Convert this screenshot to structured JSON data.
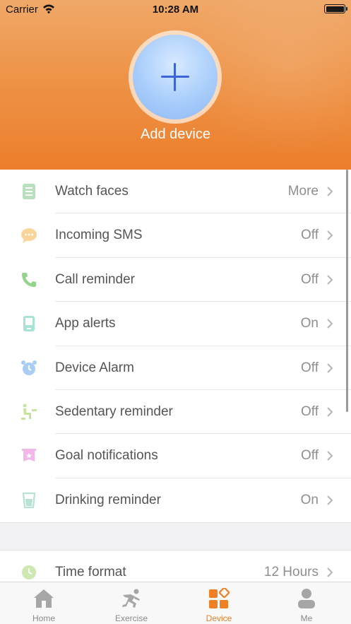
{
  "status_bar": {
    "carrier": "Carrier",
    "time": "10:28 AM"
  },
  "header": {
    "add_device_label": "Add device"
  },
  "settings": [
    {
      "label": "Watch faces",
      "value": "More",
      "icon": "watch-face-icon",
      "color": "#b9dfbd"
    },
    {
      "label": "Incoming SMS",
      "value": "Off",
      "icon": "chat-bubble-icon",
      "color": "#f9d59a"
    },
    {
      "label": "Call reminder",
      "value": "Off",
      "icon": "phone-icon",
      "color": "#93d38b"
    },
    {
      "label": "App alerts",
      "value": "On",
      "icon": "phone-alert-icon",
      "color": "#a9e3d6"
    },
    {
      "label": "Device Alarm",
      "value": "Off",
      "icon": "alarm-clock-icon",
      "color": "#a9cdf3"
    },
    {
      "label": "Sedentary reminder",
      "value": "Off",
      "icon": "sitting-person-icon",
      "color": "#c6e59b"
    },
    {
      "label": "Goal notifications",
      "value": "Off",
      "icon": "goal-flag-icon",
      "color": "#f3b6e8"
    },
    {
      "label": "Drinking reminder",
      "value": "On",
      "icon": "water-glass-icon",
      "color": "#b8e2d3"
    }
  ],
  "time_format": {
    "label": "Time format",
    "value": "12 Hours",
    "icon": "clock-icon",
    "color": "#cde8b0"
  },
  "tabs": [
    {
      "label": "Home",
      "icon": "home-icon",
      "active": false
    },
    {
      "label": "Exercise",
      "icon": "running-icon",
      "active": false
    },
    {
      "label": "Device",
      "icon": "device-grid-icon",
      "active": true
    },
    {
      "label": "Me",
      "icon": "person-icon",
      "active": false
    }
  ],
  "colors": {
    "accent": "#ee7f22",
    "plus": "#3c63d8",
    "header_top": "#f0a868",
    "header_bottom": "#ec7e2c"
  }
}
